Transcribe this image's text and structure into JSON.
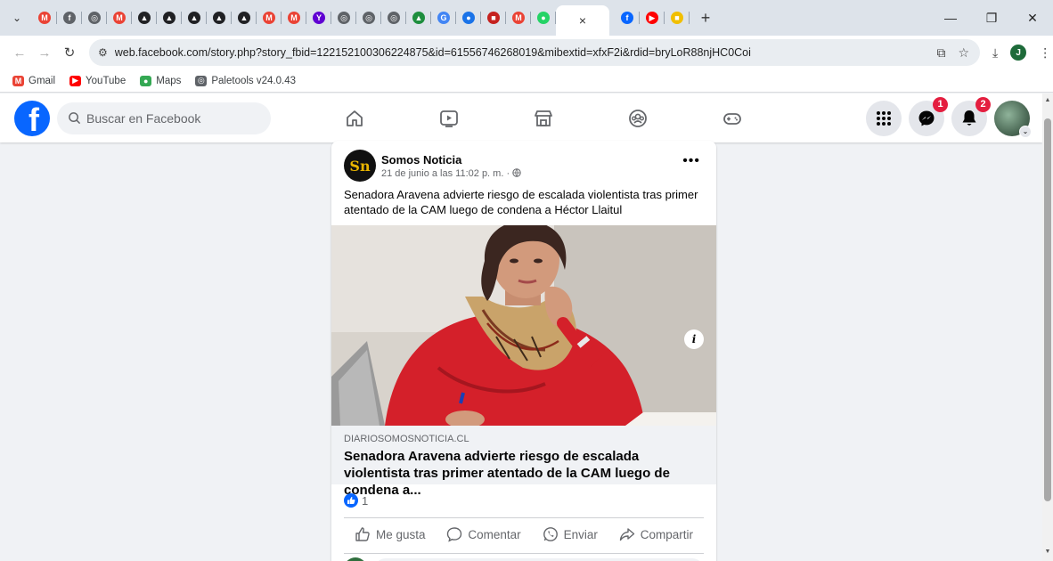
{
  "browser": {
    "tabs": [
      {
        "name": "tab-gmail-1",
        "glyph": "M",
        "color": "#ea4335"
      },
      {
        "name": "tab-facebook-old",
        "glyph": "f",
        "color": "#5f6368"
      },
      {
        "name": "tab-chrome-1",
        "glyph": "◎",
        "color": "#5f6368"
      },
      {
        "name": "tab-gmail-2",
        "glyph": "M",
        "color": "#ea4335"
      },
      {
        "name": "tab-a-1",
        "glyph": "▲",
        "color": "#202124"
      },
      {
        "name": "tab-a-2",
        "glyph": "▲",
        "color": "#202124"
      },
      {
        "name": "tab-a-3",
        "glyph": "▲",
        "color": "#202124"
      },
      {
        "name": "tab-a-4",
        "glyph": "▲",
        "color": "#202124"
      },
      {
        "name": "tab-a-5",
        "glyph": "▲",
        "color": "#202124"
      },
      {
        "name": "tab-gmail-3",
        "glyph": "M",
        "color": "#ea4335"
      },
      {
        "name": "tab-gmail-4",
        "glyph": "M",
        "color": "#ea4335"
      },
      {
        "name": "tab-yahoo",
        "glyph": "Y",
        "color": "#6001d2"
      },
      {
        "name": "tab-chrome-2",
        "glyph": "◎",
        "color": "#5f6368"
      },
      {
        "name": "tab-chrome-3",
        "glyph": "◎",
        "color": "#5f6368"
      },
      {
        "name": "tab-chrome-4",
        "glyph": "◎",
        "color": "#5f6368"
      },
      {
        "name": "tab-drive",
        "glyph": "▲",
        "color": "#1e8e3e"
      },
      {
        "name": "tab-google",
        "glyph": "G",
        "color": "#4285f4"
      },
      {
        "name": "tab-chat",
        "glyph": "●",
        "color": "#1a73e8"
      },
      {
        "name": "tab-flag",
        "glyph": "■",
        "color": "#c5221f"
      },
      {
        "name": "tab-gmail-5",
        "glyph": "M",
        "color": "#ea4335"
      },
      {
        "name": "tab-whatsapp",
        "glyph": "●",
        "color": "#25d366"
      }
    ],
    "active_tab_glyph": "×",
    "tabs_after": [
      {
        "name": "tab-facebook",
        "glyph": "f",
        "color": "#0866ff"
      },
      {
        "name": "tab-youtube",
        "glyph": "▶",
        "color": "#ff0000"
      },
      {
        "name": "tab-spain",
        "glyph": "■",
        "color": "#f1bf00"
      }
    ],
    "new_tab_label": "+",
    "url": "web.facebook.com/story.php?story_fbid=122152100306224875&id=61556746268019&mibextid=xfxF2i&rdid=bryLoR88njHC0Coi",
    "profile_initial": "J",
    "bookmarks": [
      {
        "name": "bookmark-gmail",
        "label": "Gmail",
        "glyph": "M",
        "color": "#ea4335"
      },
      {
        "name": "bookmark-youtube",
        "label": "YouTube",
        "glyph": "▶",
        "color": "#ff0000"
      },
      {
        "name": "bookmark-maps",
        "label": "Maps",
        "glyph": "●",
        "color": "#34a853"
      },
      {
        "name": "bookmark-paletools",
        "label": "Paletools v24.0.43",
        "glyph": "◎",
        "color": "#5f6368"
      }
    ]
  },
  "facebook": {
    "search_placeholder": "Buscar en Facebook",
    "messenger_badge": "1",
    "notifications_badge": "2"
  },
  "post": {
    "page_name": "Somos Noticia",
    "logo_text": "Sn",
    "timestamp": "21 de junio a las 11:02 p. m. ·",
    "more_label": "•••",
    "text": "Senadora Aravena advierte riesgo de escalada violentista tras primer atentado de la CAM luego de condena a Héctor Llaitul",
    "link_domain": "DIARIOSOMOSNOTICIA.CL",
    "link_title": "Senadora Aravena advierte riesgo de escalada violentista tras primer atentado de la CAM luego de condena a...",
    "info_label": "i",
    "reaction_count": "1",
    "actions": {
      "like": "Me gusta",
      "comment": "Comentar",
      "send": "Enviar",
      "share": "Compartir"
    }
  },
  "colors": {
    "facebook_blue": "#0866ff",
    "badge_red": "#e41e3f"
  }
}
